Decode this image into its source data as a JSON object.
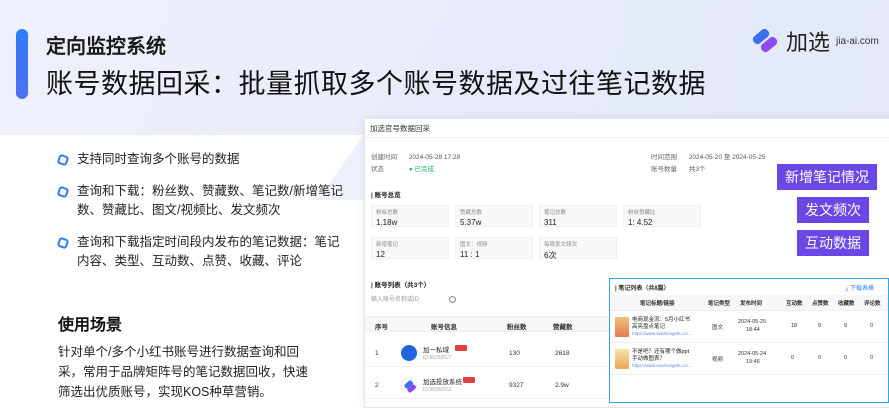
{
  "header": {
    "eyebrow": "定向监控系统",
    "headline": "账号数据回采：批量抓取多个账号数据及过往笔记数据"
  },
  "brand": {
    "name": "加选",
    "domain": "jia-ai.com"
  },
  "features": [
    "支持同时查询多个账号的数据",
    "查询和下载：粉丝数、赞藏数、笔记数/新增笔记数、赞藏比、图文/视频比、发文频次",
    "查询和下载指定时间段内发布的笔记数据：笔记内容、类型、互动数、点赞、收藏、评论"
  ],
  "usage": {
    "title": "使用场景",
    "text": "针对单个/多个小红书账号进行数据查询和回采，常用于品牌矩阵号的笔记数据回收，快速筛选出优质账号，实现KOS种草营销。"
  },
  "panel": {
    "title": "加选官号数据回采",
    "created_label": "创建时间",
    "created_value": "2024-05-28 17:28",
    "status_label": "状态",
    "status_value": "● 已完成",
    "range_label": "时间范围",
    "range_value": "2024-05-20 至 2024-05-25",
    "count_label": "账号数量",
    "count_value": "共3个",
    "overview_title": "| 账号总览",
    "stats": [
      {
        "label": "粉丝总数",
        "value": "1.18w"
      },
      {
        "label": "赞藏总数",
        "value": "5.37w"
      },
      {
        "label": "笔记总数",
        "value": "311"
      },
      {
        "label": "粉丝赞藏比",
        "value": "1: 4.52"
      },
      {
        "label": "新增笔记",
        "value": "12"
      },
      {
        "label": "图文：视频",
        "value": "11 : 1"
      },
      {
        "label": "每周发文频次",
        "value": "6次"
      }
    ],
    "list_title": "| 账号列表（共3个）",
    "search_placeholder": "输入账号名称或ID",
    "columns": [
      "序号",
      "账号信息",
      "粉丝数",
      "赞藏数"
    ],
    "rows": [
      {
        "no": "1",
        "name": "加一私域",
        "id": "ID:86058527",
        "fans": "130",
        "likes": "2618"
      },
      {
        "no": "2",
        "name": "加选投放系统",
        "id": "ID:95550552",
        "fans": "9327",
        "likes": "2.9w"
      }
    ]
  },
  "tags": [
    "新增笔记情况",
    "发文频次",
    "互动数据"
  ],
  "subpanel": {
    "title": "| 笔记列表（共8篇）",
    "download": "⤓ 下载表格",
    "columns": [
      "笔记标题/链接",
      "笔记类型",
      "发布时间",
      "互动数",
      "点赞数",
      "收藏数",
      "评论数"
    ],
    "rows": [
      {
        "title": "电商现金流：5月小红书高亮盘点笔记",
        "link": "https://www.xiaohongshu.co…",
        "type": "图文",
        "date": "2024-05-25",
        "time": "18:44",
        "inter": "18",
        "like": "9",
        "fav": "9",
        "cmt": "0"
      },
      {
        "title": "不是吧？还有哪个做ppt手动做图表？",
        "link": "https://www.xiaohongshu.co…",
        "type": "视频",
        "date": "2024-05-24",
        "time": "19:46",
        "inter": "0",
        "like": "0",
        "fav": "0",
        "cmt": "0"
      }
    ]
  }
}
